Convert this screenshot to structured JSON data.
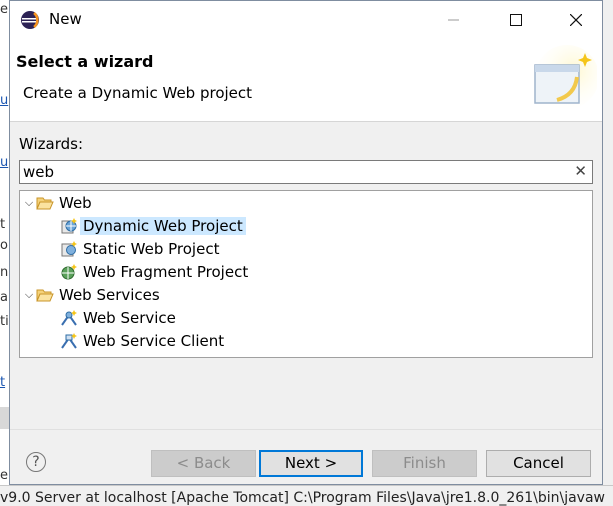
{
  "window": {
    "title": "New"
  },
  "banner": {
    "title": "Select a wizard",
    "description": "Create a Dynamic Web project"
  },
  "wizards": {
    "label": "Wizards:",
    "filter_value": "web",
    "tree": [
      {
        "label": "Web",
        "expanded": true,
        "children": [
          {
            "label": "Dynamic Web Project",
            "selected": true
          },
          {
            "label": "Static Web Project"
          },
          {
            "label": "Web Fragment Project"
          }
        ]
      },
      {
        "label": "Web Services",
        "expanded": true,
        "children": [
          {
            "label": "Web Service"
          },
          {
            "label": "Web Service Client"
          }
        ]
      }
    ]
  },
  "buttons": {
    "help": "?",
    "back": "< Back",
    "next": "Next >",
    "finish": "Finish",
    "cancel": "Cancel"
  },
  "background": {
    "fragments": [
      "e",
      "u",
      "t",
      "o",
      "ne",
      "all",
      "ti",
      "t",
      "e"
    ],
    "status": "v9.0 Server at localhost [Apache Tomcat] C:\\Program Files\\Java\\jre1.8.0_261\\bin\\javaw"
  },
  "colors": {
    "selection": "#cce8ff",
    "default_button_border": "#0078d7",
    "folder": "#e8b84a"
  }
}
